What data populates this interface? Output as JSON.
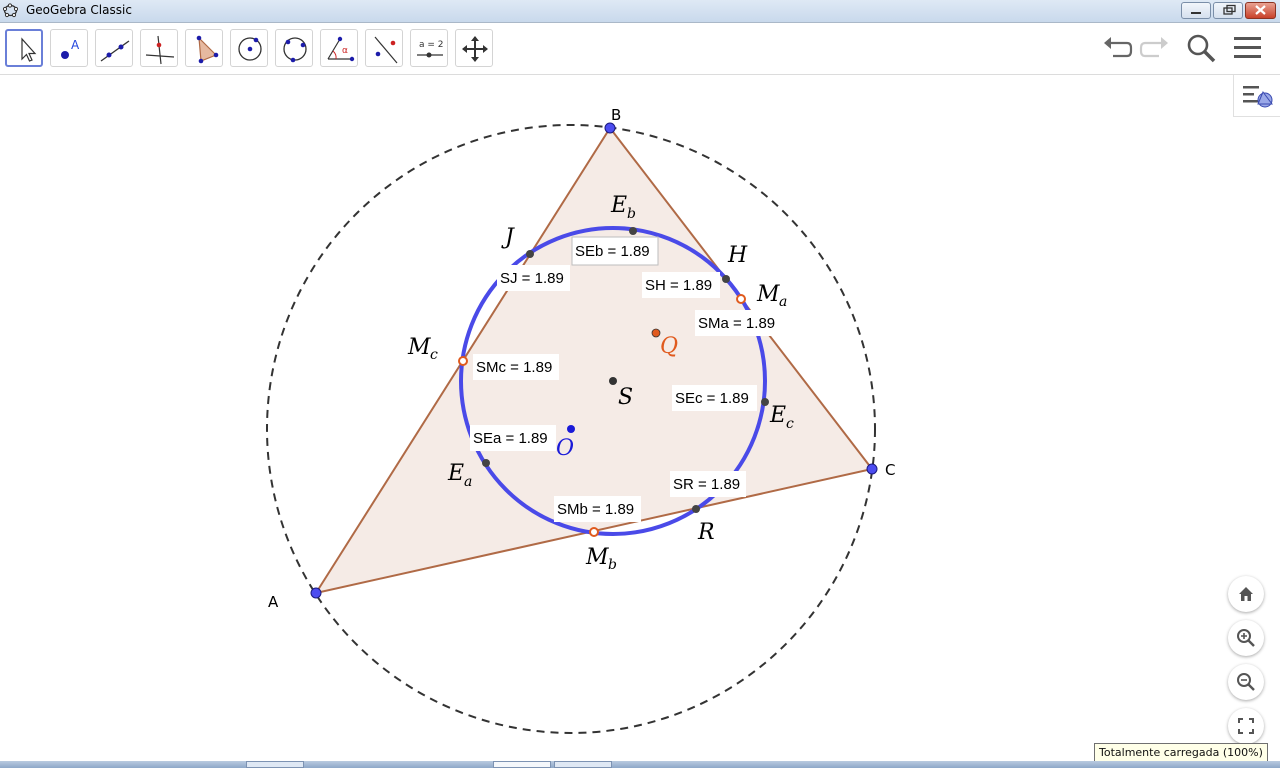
{
  "window": {
    "title": "GeoGebra Classic"
  },
  "toolbar": {
    "tools": [
      {
        "name": "move-tool"
      },
      {
        "name": "point-tool"
      },
      {
        "name": "line-tool"
      },
      {
        "name": "perpendicular-tool"
      },
      {
        "name": "polygon-tool"
      },
      {
        "name": "circle-center-point-tool"
      },
      {
        "name": "circle-three-points-tool"
      },
      {
        "name": "angle-tool"
      },
      {
        "name": "reflect-tool"
      },
      {
        "name": "slider-tool"
      },
      {
        "name": "move-graphics-tool"
      }
    ],
    "slider_label": "a = 2"
  },
  "canvas": {
    "points": {
      "A": "A",
      "B": "B",
      "C": "C",
      "J": "J",
      "H": "H",
      "Q": "Q",
      "S": "S",
      "O": "O",
      "R": "R",
      "Eb": "E",
      "Eb_sub": "b",
      "Ma": "M",
      "Ma_sub": "a",
      "Mc": "M",
      "Mc_sub": "c",
      "Ec": "E",
      "Ec_sub": "c",
      "Ea": "E",
      "Ea_sub": "a",
      "Mb": "M",
      "Mb_sub": "b"
    },
    "value_labels": {
      "SEb": "SEb = 1.89",
      "SJ": "SJ = 1.89",
      "SH": "SH = 1.89",
      "SMa": "SMa = 1.89",
      "SMc": "SMc = 1.89",
      "SEc": "SEc = 1.89",
      "SEa": "SEa = 1.89",
      "SR": "SR = 1.89",
      "SMb": "SMb = 1.89"
    }
  },
  "status": {
    "tooltip": "Totalmente carregada (100%)"
  },
  "colors": {
    "triangle_fill": "#f2e4de",
    "triangle_edge": "#b06a46",
    "circle": "#4a4ae8",
    "vertex_point": "#4c4cf0",
    "highlight_point": "#e05a1e",
    "label_blue": "#1a1ad8",
    "label_orange": "#e05a1e"
  }
}
